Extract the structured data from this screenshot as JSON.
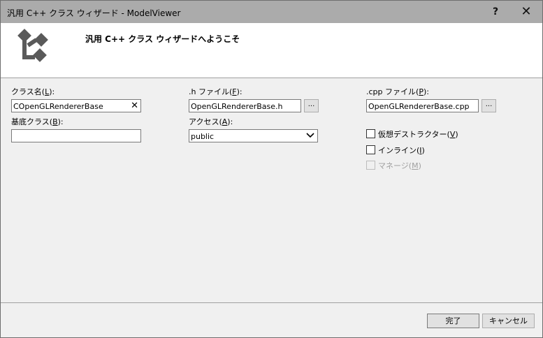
{
  "window": {
    "title": "汎用 C++ クラス ウィザード - ModelViewer",
    "help_glyph": "?",
    "close_glyph": "✕"
  },
  "banner": {
    "heading": "汎用 C++ クラス ウィザードへようこそ"
  },
  "form": {
    "class_name": {
      "label": "クラス名(",
      "mnemonic": "L",
      "label_end": "):",
      "value": "COpenGLRendererBase"
    },
    "h_file": {
      "label": ".h ファイル(",
      "mnemonic": "F",
      "label_end": "):",
      "value": "OpenGLRendererBase.h",
      "browse": "..."
    },
    "cpp_file": {
      "label": ".cpp ファイル(",
      "mnemonic": "P",
      "label_end": "):",
      "value": "OpenGLRendererBase.cpp",
      "browse": "..."
    },
    "base_class": {
      "label": "基底クラス(",
      "mnemonic": "B",
      "label_end": "):",
      "value": ""
    },
    "access": {
      "label": "アクセス(",
      "mnemonic": "A",
      "label_end": "):",
      "value": "public"
    },
    "options": {
      "virtual_dtor": {
        "label": "仮想デストラクター(",
        "mnemonic": "V",
        "label_end": ")",
        "checked": false,
        "enabled": true
      },
      "inline": {
        "label": "インライン(",
        "mnemonic": "I",
        "label_end": ")",
        "checked": false,
        "enabled": true
      },
      "managed": {
        "label": "マネージ(",
        "mnemonic": "M",
        "label_end": ")",
        "checked": false,
        "enabled": false
      }
    }
  },
  "buttons": {
    "finish": "完了",
    "cancel": "キャンセル"
  },
  "colors": {
    "titlebar": "#ababab",
    "banner": "#ffffff",
    "dialog": "#f0f0f0",
    "disabled_text": "#a0a0a0"
  }
}
